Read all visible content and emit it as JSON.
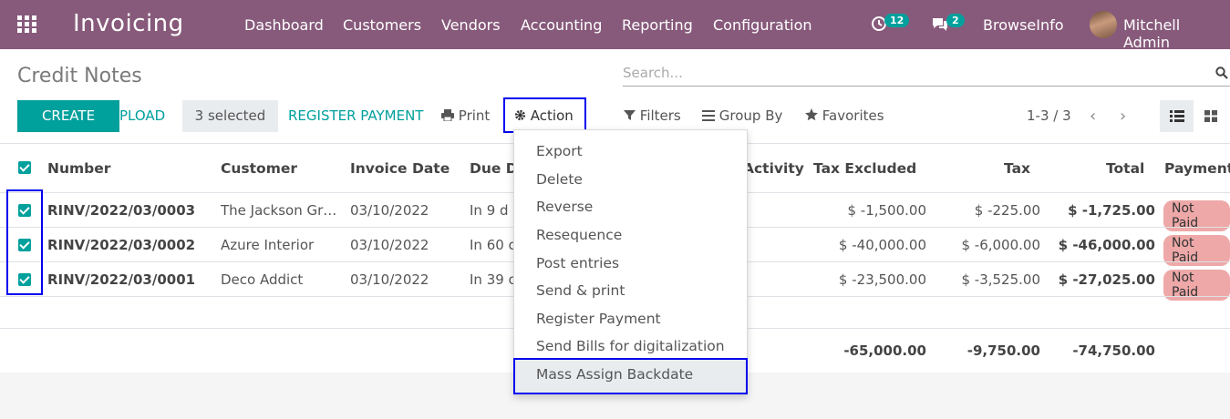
{
  "nav": {
    "app_title": "Invoicing",
    "menus": [
      "Dashboard",
      "Customers",
      "Vendors",
      "Accounting",
      "Reporting",
      "Configuration"
    ],
    "activity_count": "12",
    "message_count": "2",
    "company": "BrowseInfo",
    "user": "Mitchell Admin"
  },
  "control": {
    "title": "Credit Notes",
    "search_placeholder": "Search...",
    "create": "CREATE",
    "upload": "UPLOAD",
    "selected": "3 selected",
    "register_payment": "REGISTER PAYMENT",
    "print": "Print",
    "action": "Action",
    "filters": "Filters",
    "group_by": "Group By",
    "favorites": "Favorites",
    "pager": "1-3 / 3"
  },
  "table": {
    "headers": {
      "number": "Number",
      "customer": "Customer",
      "invoice_date": "Invoice Date",
      "due_date": "Due D",
      "activity": "Activity",
      "tax_excluded": "Tax Excluded",
      "tax": "Tax",
      "total": "Total",
      "payment": "Payment"
    },
    "rows": [
      {
        "number": "RINV/2022/03/0003",
        "customer": "The Jackson Gr…",
        "invoice_date": "03/10/2022",
        "due": "In 9 d",
        "tax_excluded": "$ -1,500.00",
        "tax": "$ -225.00",
        "total": "$ -1,725.00",
        "status": "Not Paid"
      },
      {
        "number": "RINV/2022/03/0002",
        "customer": "Azure Interior",
        "invoice_date": "03/10/2022",
        "due": "In 60 c",
        "tax_excluded": "$ -40,000.00",
        "tax": "$ -6,000.00",
        "total": "$ -46,000.00",
        "status": "Not Paid"
      },
      {
        "number": "RINV/2022/03/0001",
        "customer": "Deco Addict",
        "invoice_date": "03/10/2022",
        "due": "In 39 c",
        "tax_excluded": "$ -23,500.00",
        "tax": "$ -3,525.00",
        "total": "$ -27,025.00",
        "status": "Not Paid"
      }
    ],
    "totals": {
      "tax_excluded": "-65,000.00",
      "tax": "-9,750.00",
      "total": "-74,750.00"
    }
  },
  "action_menu": {
    "items": [
      "Export",
      "Delete",
      "Reverse",
      "Resequence",
      "Post entries",
      "Send & print",
      "Register Payment",
      "Send Bills for digitalization",
      "Mass Assign Backdate"
    ]
  },
  "colors": {
    "brand": "#875a7b",
    "accent": "#00a09d",
    "highlight_border": "#0000ee",
    "status_not_paid": "#eea8a8"
  }
}
